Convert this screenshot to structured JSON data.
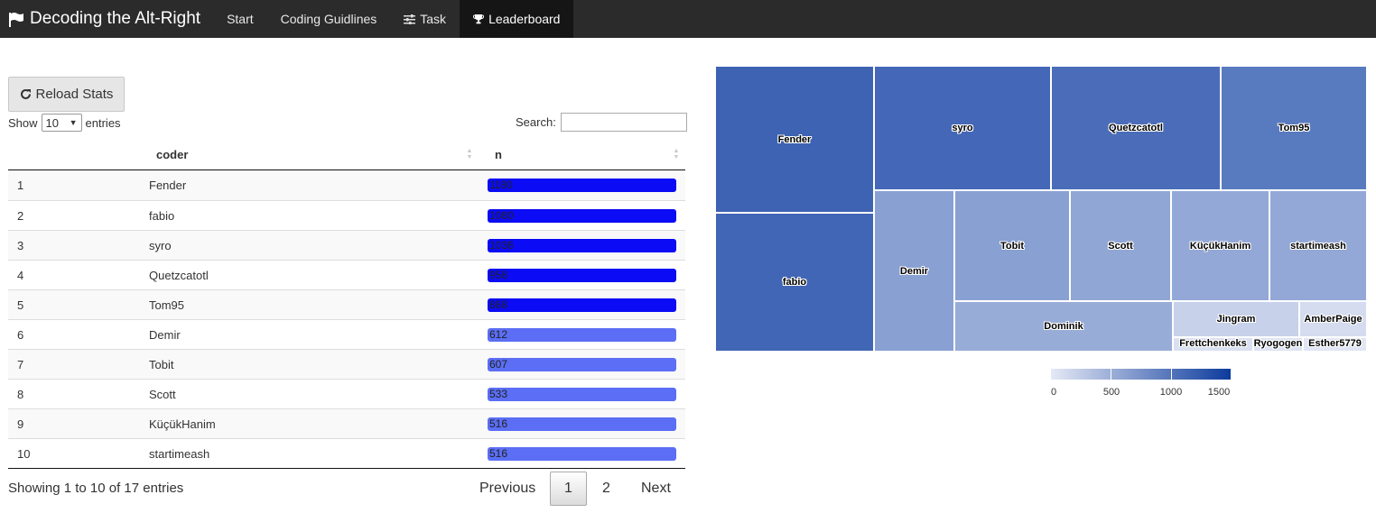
{
  "navbar": {
    "brand": "Decoding the Alt-Right",
    "brand_icon": "flag-icon",
    "items": [
      {
        "label": "Start",
        "icon": ""
      },
      {
        "label": "Coding Guidlines",
        "icon": ""
      },
      {
        "label": "Task",
        "icon": "sliders-icon"
      },
      {
        "label": "Leaderboard",
        "icon": "trophy-icon"
      }
    ],
    "active": "Leaderboard"
  },
  "controls": {
    "reload_label": "Reload Stats",
    "reload_icon": "refresh-icon",
    "show_label": "Show",
    "entries_label": "entries",
    "page_size": "10",
    "search_label": "Search:",
    "search_value": ""
  },
  "table": {
    "columns": [
      "",
      "coder",
      "n"
    ],
    "rows": [
      {
        "idx": "1",
        "coder": "Fender",
        "n": "1180",
        "color": "#0b0bf5"
      },
      {
        "idx": "2",
        "coder": "fabio",
        "n": "1080",
        "color": "#0b0bf5"
      },
      {
        "idx": "3",
        "coder": "syro",
        "n": "1036",
        "color": "#0b0bf5"
      },
      {
        "idx": "4",
        "coder": "Quetzcatotl",
        "n": "958",
        "color": "#0b0bf5"
      },
      {
        "idx": "5",
        "coder": "Tom95",
        "n": "868",
        "color": "#0b0bf5"
      },
      {
        "idx": "6",
        "coder": "Demir",
        "n": "612",
        "color": "#5b6ef5"
      },
      {
        "idx": "7",
        "coder": "Tobit",
        "n": "607",
        "color": "#5b6ef5"
      },
      {
        "idx": "8",
        "coder": "Scott",
        "n": "533",
        "color": "#5b6ef5"
      },
      {
        "idx": "9",
        "coder": "KüçükHanim",
        "n": "516",
        "color": "#5b6ef5"
      },
      {
        "idx": "10",
        "coder": "startimeash",
        "n": "516",
        "color": "#5b6ef5"
      }
    ],
    "info": "Showing 1 to 10 of 17 entries",
    "pagination": {
      "previous": "Previous",
      "pages": [
        "1",
        "2"
      ],
      "current": "1",
      "next": "Next"
    }
  },
  "treemap": {
    "cells": [
      {
        "label": "Fender",
        "color": "#3e63b3"
      },
      {
        "label": "fabio",
        "color": "#4166b5"
      },
      {
        "label": "syro",
        "color": "#4467b7"
      },
      {
        "label": "Quetzcatotl",
        "color": "#4b6db9"
      },
      {
        "label": "Tom95",
        "color": "#587abf"
      },
      {
        "label": "Demir",
        "color": "#89a0d2"
      },
      {
        "label": "Tobit",
        "color": "#89a0d2"
      },
      {
        "label": "Scott",
        "color": "#90a6d5"
      },
      {
        "label": "KüçükHanim",
        "color": "#93a8d6"
      },
      {
        "label": "startimeash",
        "color": "#93a8d6"
      },
      {
        "label": "Dominik",
        "color": "#97acd7"
      },
      {
        "label": "Jingram",
        "color": "#c7d1ea"
      },
      {
        "label": "AmberPaige",
        "color": "#d5dcef"
      },
      {
        "label": "Frettchenkeks",
        "color": "#d9e0f1"
      },
      {
        "label": "Ryogogen",
        "color": "#dde3f2"
      },
      {
        "label": "Esther5779",
        "color": "#e1e6f4"
      }
    ]
  },
  "legend": {
    "colors": [
      "#e6eaf6",
      "#0b3a9c"
    ],
    "labels": [
      "0",
      "500",
      "1000",
      "1500"
    ]
  }
}
